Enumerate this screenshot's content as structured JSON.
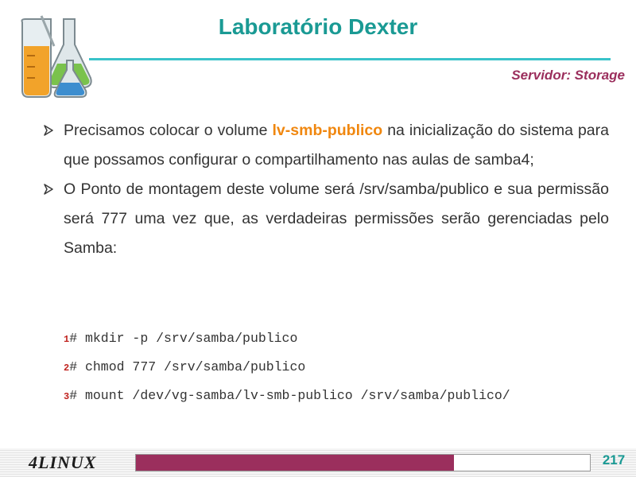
{
  "header": {
    "title": "Laboratório Dexter",
    "subtitle": "Servidor: Storage"
  },
  "bullets": [
    {
      "before": "Precisamos colocar o volume ",
      "highlight": "lv-smb-publico",
      "after": " na inicialização do sistema para que possamos configurar o compartilhamento nas aulas de samba4;"
    },
    {
      "text": "O Ponto de montagem deste volume será /srv/samba/publico e sua permissão será 777 uma vez que, as verdadeiras permissões serão gerenciadas pelo Samba:"
    }
  ],
  "code": [
    {
      "num": "1",
      "text": "# mkdir -p /srv/samba/publico"
    },
    {
      "num": "2",
      "text": "# chmod 777 /srv/samba/publico"
    },
    {
      "num": "3",
      "text": "# mount /dev/vg-samba/lv-smb-publico /srv/samba/publico/"
    }
  ],
  "footer": {
    "brand": "4LINUX",
    "page": "217",
    "progress": 0.7
  },
  "colors": {
    "title": "#1a9a94",
    "accent_line": "#39c3c9",
    "subtitle": "#9b2f5d",
    "highlight": "#f0870f",
    "progress": "#9b2f5d"
  },
  "icons": [
    "lab-glassware-logo",
    "arrow-bullet-icon"
  ]
}
